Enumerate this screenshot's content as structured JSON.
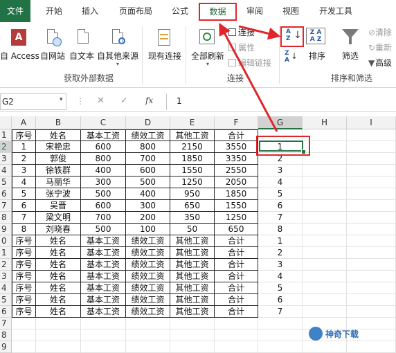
{
  "tabs": [
    "文件",
    "开始",
    "插入",
    "页面布局",
    "公式",
    "数据",
    "审阅",
    "视图",
    "开发工具"
  ],
  "ribbon": {
    "access": "自 Access",
    "web": "自网站",
    "text": "自文本",
    "other": "自其他来源",
    "existing": "现有连接",
    "refresh_all": "全部刷新",
    "connections": "连接",
    "properties": "属性",
    "edit_links": "编辑链接",
    "sort": "排序",
    "filter": "筛选",
    "clear": "清除",
    "reapply": "重新",
    "advanced": "高级",
    "group_external": "获取外部数据",
    "group_connections": "连接",
    "group_sort_filter": "排序和筛选"
  },
  "formula_bar": {
    "name_box": "G2",
    "fx": "fx",
    "value": "1"
  },
  "columns": [
    "A",
    "B",
    "C",
    "D",
    "E",
    "F",
    "G",
    "H",
    "I"
  ],
  "rows": [
    "1",
    "2",
    "3",
    "4",
    "5",
    "6",
    "7",
    "8",
    "9",
    "0",
    "1",
    "2",
    "3",
    "4",
    "5",
    "6",
    "7",
    "8",
    "9"
  ],
  "table": [
    [
      "序号",
      "姓名",
      "基本工资",
      "绩效工资",
      "其他工资",
      "合计",
      ""
    ],
    [
      "1",
      "宋艳忠",
      "600",
      "800",
      "2150",
      "3550",
      "1"
    ],
    [
      "2",
      "郭俊",
      "800",
      "700",
      "1850",
      "3350",
      "2"
    ],
    [
      "3",
      "徐轶群",
      "400",
      "600",
      "1550",
      "2550",
      "3"
    ],
    [
      "4",
      "马丽华",
      "300",
      "500",
      "1250",
      "2050",
      "4"
    ],
    [
      "5",
      "张宁波",
      "500",
      "400",
      "950",
      "1850",
      "5"
    ],
    [
      "6",
      "吴晋",
      "600",
      "300",
      "650",
      "1550",
      "6"
    ],
    [
      "7",
      "梁文明",
      "700",
      "200",
      "350",
      "1250",
      "7"
    ],
    [
      "8",
      "刘晓春",
      "500",
      "100",
      "50",
      "650",
      "8"
    ],
    [
      "序号",
      "姓名",
      "基本工资",
      "绩效工资",
      "其他工资",
      "合计",
      "1"
    ],
    [
      "序号",
      "姓名",
      "基本工资",
      "绩效工资",
      "其他工资",
      "合计",
      "2"
    ],
    [
      "序号",
      "姓名",
      "基本工资",
      "绩效工资",
      "其他工资",
      "合计",
      "3"
    ],
    [
      "序号",
      "姓名",
      "基本工资",
      "绩效工资",
      "其他工资",
      "合计",
      "4"
    ],
    [
      "序号",
      "姓名",
      "基本工资",
      "绩效工资",
      "其他工资",
      "合计",
      "5"
    ],
    [
      "序号",
      "姓名",
      "基本工资",
      "绩效工资",
      "其他工资",
      "合计",
      "6"
    ],
    [
      "序号",
      "姓名",
      "基本工资",
      "绩效工资",
      "其他工资",
      "合计",
      "7"
    ]
  ],
  "watermark": "神奇下载",
  "colors": {
    "excel_green": "#217346",
    "highlight_red": "#e0262a"
  }
}
